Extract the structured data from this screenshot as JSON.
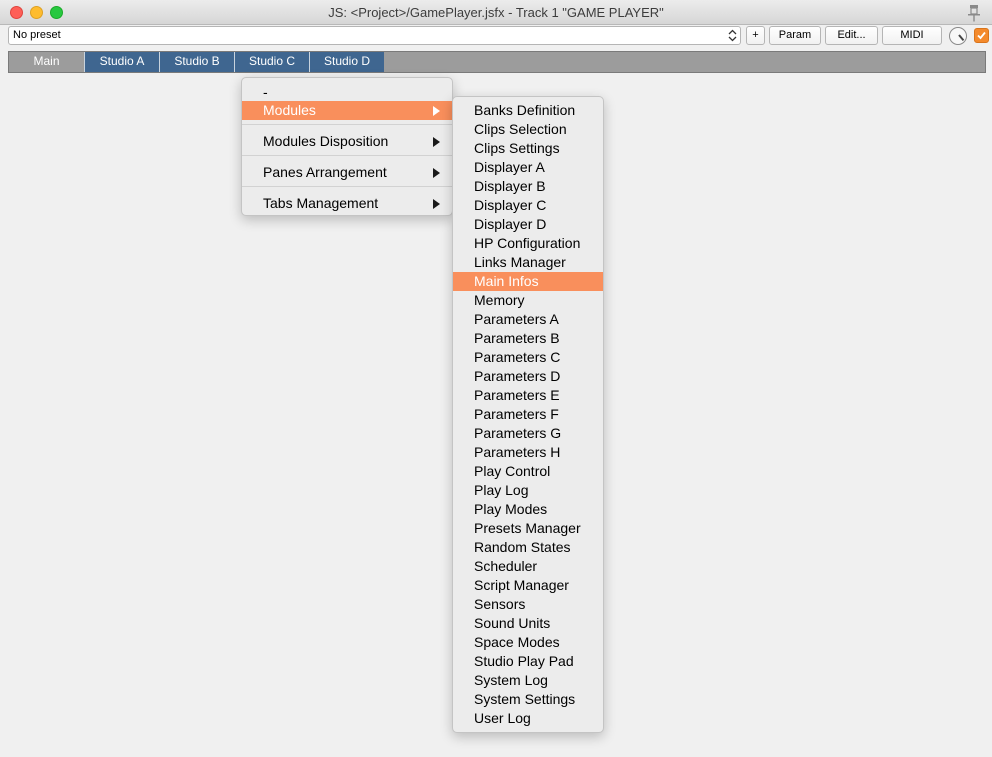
{
  "window": {
    "title": "JS: <Project>/GamePlayer.jsfx - Track 1 \"GAME PLAYER\""
  },
  "toolbar": {
    "preset_value": "No preset",
    "add_label": "+",
    "param_label": "Param",
    "edit_label": "Edit...",
    "midi_label": "MIDI",
    "enabled_checked": true
  },
  "tabs": [
    "Main",
    "Studio A",
    "Studio B",
    "Studio C",
    "Studio D"
  ],
  "active_tab": "Main",
  "context_menu": {
    "items": [
      {
        "label": "-"
      },
      {
        "label": "Modules",
        "submenu": true,
        "highlighted": true
      },
      {
        "label": "Modules Disposition",
        "submenu": true
      },
      {
        "label": "Panes Arrangement",
        "submenu": true
      },
      {
        "label": "Tabs Management",
        "submenu": true
      }
    ]
  },
  "modules_menu": {
    "items": [
      "Banks Definition",
      "Clips Selection",
      "Clips Settings",
      "Displayer A",
      "Displayer B",
      "Displayer C",
      "Displayer D",
      "HP Configuration",
      "Links Manager",
      "Main Infos",
      "Memory",
      "Parameters A",
      "Parameters B",
      "Parameters C",
      "Parameters D",
      "Parameters E",
      "Parameters F",
      "Parameters G",
      "Parameters H",
      "Play Control",
      "Play Log",
      "Play Modes",
      "Presets Manager",
      "Random States",
      "Scheduler",
      "Script Manager",
      "Sensors",
      "Sound Units",
      "Space Modes",
      "Studio Play Pad",
      "System Log",
      "System Settings",
      "User Log"
    ],
    "highlighted": "Main Infos"
  },
  "colors": {
    "menu_highlight": "#f98f5c",
    "tab_inactive": "#3f6690",
    "tab_active": "#9c9c9c",
    "checkbox": "#f48a2c"
  }
}
